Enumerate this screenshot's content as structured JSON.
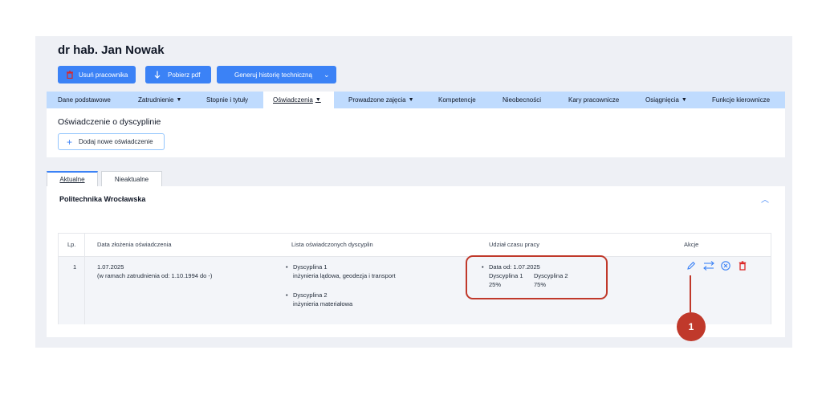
{
  "header": {
    "title": "dr hab. Jan Nowak"
  },
  "toolbar": {
    "delete_label": "Usuń pracownika",
    "download_label": "Pobierz pdf",
    "generate_label": "Generuj historię techniczną"
  },
  "nav_tabs": [
    {
      "label": "Dane podstawowe"
    },
    {
      "label": "Zatrudnienie"
    },
    {
      "label": "Stopnie i tytuły"
    },
    {
      "label": "Oświadczenia"
    },
    {
      "label": "Prowadzone zajęcia"
    },
    {
      "label": "Kompetencje"
    },
    {
      "label": "Nieobecności"
    },
    {
      "label": "Kary pracownicze"
    },
    {
      "label": "Osiągnięcia"
    },
    {
      "label": "Funkcje kierownicze"
    }
  ],
  "section": {
    "title": "Oświadczenie o dyscyplinie",
    "add_label": "Dodaj nowe oświadczenie"
  },
  "content_tabs": [
    {
      "label": "Aktualne"
    },
    {
      "label": "Nieaktualne"
    }
  ],
  "org": {
    "name": "Politechnika Wrocławska"
  },
  "table": {
    "headers": [
      "Lp.",
      "Data złożenia oświadczenia",
      "Lista oświadczonych dyscyplin",
      "Udział czasu pracy",
      "Akcje"
    ],
    "rows": [
      {
        "lp": "1",
        "date": "1.07.2025",
        "date_note": "(w ramach zatrudnienia od: 1.10.1994 do -)",
        "disciplines": [
          {
            "label": "Dyscyplina 1",
            "name": "inżynieria lądowa, geodezja i transport"
          },
          {
            "label": "Dyscyplina 2",
            "name": "inżynieria materiałowa"
          }
        ],
        "share": {
          "date": "Data od: 1.07.2025",
          "d1_label": "Dyscyplina 1",
          "d2_label": "Dyscyplina 2",
          "d1_value": "25%",
          "d2_value": "75%"
        }
      }
    ]
  },
  "annotation": {
    "marker": "1"
  },
  "colors": {
    "accent": "#3b82f6",
    "danger": "#dc2626",
    "highlight": "#c0392b"
  }
}
